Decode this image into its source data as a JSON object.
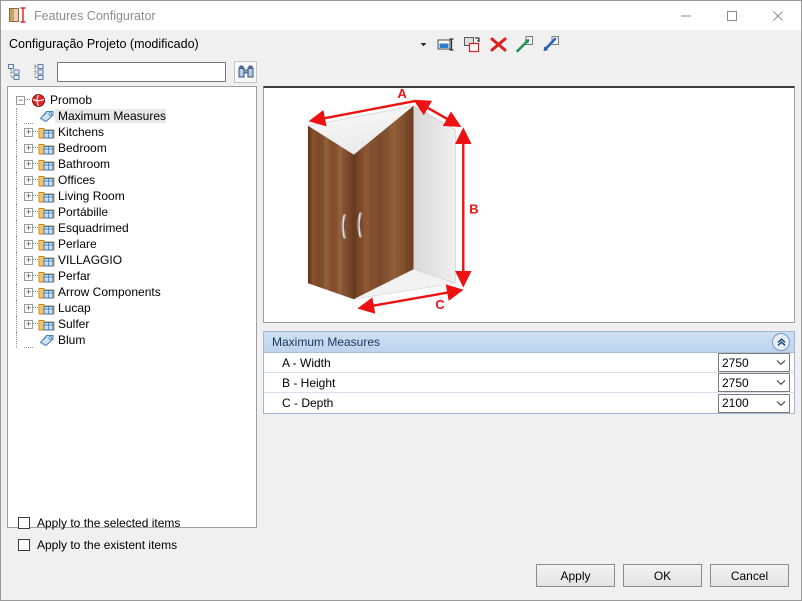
{
  "window": {
    "title": "Features Configurator",
    "app_icon": "cabinet-ruler-icon",
    "controls": {
      "minimize": "minimize-icon",
      "maximize": "maximize-icon",
      "close": "close-icon"
    }
  },
  "toolbar": {
    "project_combo_value": "Configuração Projeto (modificado)",
    "icons": [
      {
        "name": "rename-icon"
      },
      {
        "name": "duplicate-icon"
      },
      {
        "name": "delete-icon"
      },
      {
        "name": "export-icon"
      },
      {
        "name": "import-icon"
      }
    ]
  },
  "tree_toolbar": {
    "collapse_all_icon": "collapse-tree-icon",
    "expand_all_icon": "expand-tree-icon",
    "search_value": "",
    "search_placeholder": "",
    "find_icon": "binoculars-icon"
  },
  "tree": {
    "root": {
      "label": "Promob",
      "icon": "promob-globe-icon",
      "expander": "−"
    },
    "items": [
      {
        "label": "Maximum Measures",
        "icon": "tag-icon",
        "expander": "",
        "selected": true
      },
      {
        "label": "Kitchens",
        "icon": "folder-icon",
        "expander": "+",
        "selected": false
      },
      {
        "label": "Bedroom",
        "icon": "folder-icon",
        "expander": "+",
        "selected": false
      },
      {
        "label": "Bathroom",
        "icon": "folder-icon",
        "expander": "+",
        "selected": false
      },
      {
        "label": "Offices",
        "icon": "folder-icon",
        "expander": "+",
        "selected": false
      },
      {
        "label": "Living Room",
        "icon": "folder-icon",
        "expander": "+",
        "selected": false
      },
      {
        "label": "Portábille",
        "icon": "folder-icon",
        "expander": "+",
        "selected": false
      },
      {
        "label": "Esquadrimed",
        "icon": "folder-icon",
        "expander": "+",
        "selected": false
      },
      {
        "label": "Perlare",
        "icon": "folder-icon",
        "expander": "+",
        "selected": false
      },
      {
        "label": "VILLAGGIO",
        "icon": "folder-icon",
        "expander": "+",
        "selected": false
      },
      {
        "label": "Perfar",
        "icon": "folder-icon",
        "expander": "+",
        "selected": false
      },
      {
        "label": "Arrow Components",
        "icon": "folder-icon",
        "expander": "+",
        "selected": false
      },
      {
        "label": "Lucap",
        "icon": "folder-icon",
        "expander": "+",
        "selected": false
      },
      {
        "label": "Sulfer",
        "icon": "folder-icon",
        "expander": "+",
        "selected": false
      },
      {
        "label": "Blum",
        "icon": "tag-icon",
        "expander": "",
        "selected": false
      }
    ]
  },
  "preview": {
    "dimension_labels": {
      "width": "A",
      "height": "B",
      "depth": "C"
    },
    "colors": {
      "dimension_line": "#ee1111",
      "wood": "#8a5433",
      "panel": "#ededed"
    }
  },
  "properties": {
    "header": "Maximum Measures",
    "collapse_icon": "chevron-double-up-icon",
    "rows": [
      {
        "label": "A - Width",
        "value": "2750"
      },
      {
        "label": "B - Height",
        "value": "2750"
      },
      {
        "label": "C - Depth",
        "value": "2100"
      }
    ]
  },
  "footer": {
    "checkboxes": [
      {
        "label": "Apply to the selected items",
        "checked": false
      },
      {
        "label": "Apply to the existent items",
        "checked": false
      }
    ],
    "buttons": [
      {
        "label": "Apply"
      },
      {
        "label": "OK"
      },
      {
        "label": "Cancel"
      }
    ]
  }
}
